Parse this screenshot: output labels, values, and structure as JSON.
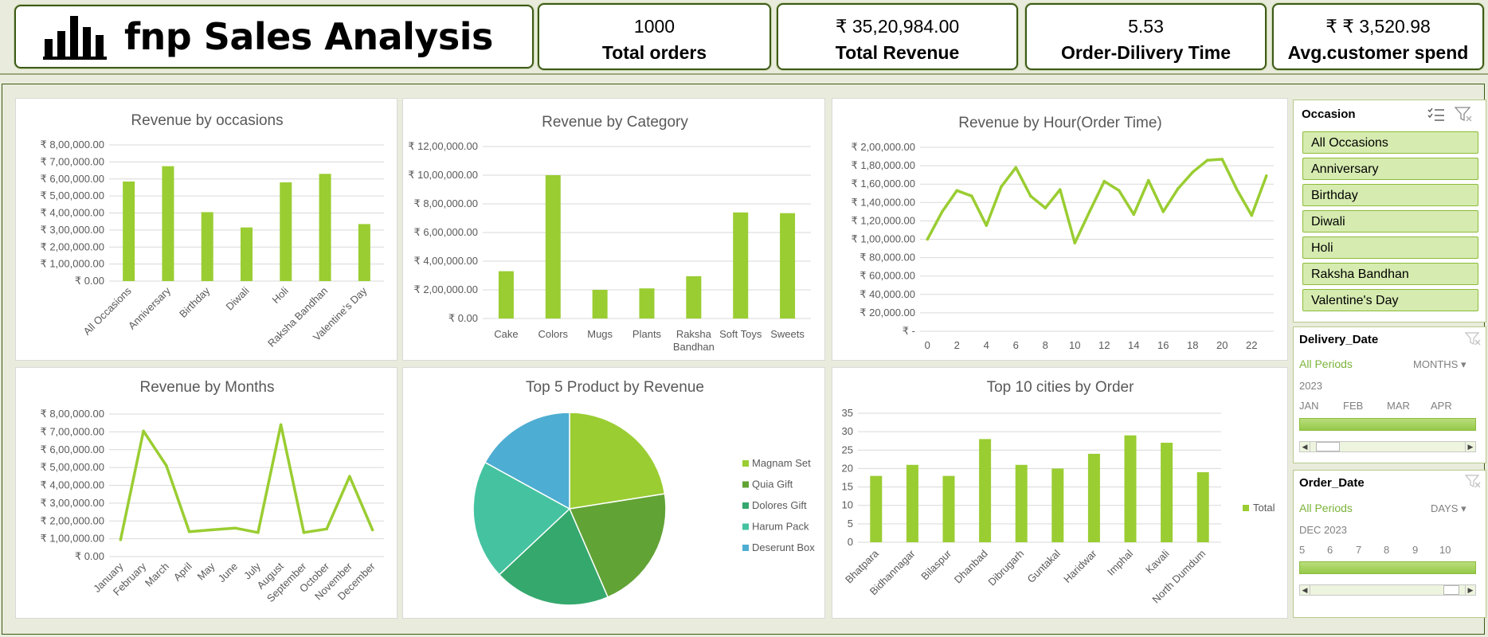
{
  "header": {
    "title": "fnp Sales Analysis",
    "logo_icon": "bar-chart-icon",
    "kpis": [
      {
        "value": "1000",
        "label": "Total orders"
      },
      {
        "value": "₹ 35,20,984.00",
        "label": "Total Revenue"
      },
      {
        "value": "5.53",
        "label": "Order-Dilivery Time"
      },
      {
        "value": "₹ ₹ 3,520.98",
        "label": "Avg.customer spend"
      }
    ]
  },
  "colors": {
    "bar": "#9acd32",
    "line": "#9acd32",
    "grid": "#d9d9d9",
    "accent": "#3c5a16"
  },
  "chart_data": [
    {
      "id": "occasion",
      "type": "bar",
      "title": "Revenue by occasions",
      "categories": [
        "All Occasions",
        "Anniversary",
        "Birthday",
        "Diwali",
        "Holi",
        "Raksha Bandhan",
        "Valentine's Day"
      ],
      "values": [
        585000,
        675000,
        405000,
        315000,
        580000,
        630000,
        335000
      ],
      "ylim": [
        0,
        800000
      ],
      "yticks": [
        0,
        100000,
        200000,
        300000,
        400000,
        500000,
        600000,
        700000,
        800000
      ],
      "ytick_labels": [
        "₹ 0.00",
        "₹ 1,00,000.00",
        "₹ 2,00,000.00",
        "₹ 3,00,000.00",
        "₹ 4,00,000.00",
        "₹ 5,00,000.00",
        "₹ 6,00,000.00",
        "₹ 7,00,000.00",
        "₹ 8,00,000.00"
      ],
      "grid": true
    },
    {
      "id": "category",
      "type": "bar",
      "title": "Revenue by Category",
      "categories": [
        "Cake",
        "Colors",
        "Mugs",
        "Plants",
        "Raksha Bandhan",
        "Soft Toys",
        "Sweets"
      ],
      "values": [
        330000,
        1000000,
        200000,
        210000,
        295000,
        740000,
        735000
      ],
      "ylim": [
        0,
        1200000
      ],
      "yticks": [
        0,
        200000,
        400000,
        600000,
        800000,
        1000000,
        1200000
      ],
      "ytick_labels": [
        "₹ 0.00",
        "₹ 2,00,000.00",
        "₹ 4,00,000.00",
        "₹ 6,00,000.00",
        "₹ 8,00,000.00",
        "₹ 10,00,000.00",
        "₹ 12,00,000.00"
      ],
      "grid": true
    },
    {
      "id": "hour",
      "type": "line",
      "title": "Revenue by Hour(Order Time)",
      "x": [
        0,
        1,
        2,
        3,
        4,
        5,
        6,
        7,
        8,
        9,
        10,
        11,
        12,
        13,
        14,
        15,
        16,
        17,
        18,
        19,
        20,
        21,
        22,
        23
      ],
      "values": [
        100000,
        130000,
        153000,
        147000,
        115000,
        157000,
        178000,
        147000,
        134000,
        154000,
        96000,
        130000,
        163000,
        153000,
        127000,
        164000,
        130000,
        155000,
        173000,
        186000,
        187000,
        154000,
        126000,
        169000
      ],
      "xticks": [
        0,
        2,
        4,
        6,
        8,
        10,
        12,
        14,
        16,
        18,
        20,
        22
      ],
      "ylim": [
        0,
        200000
      ],
      "yticks": [
        0,
        20000,
        40000,
        60000,
        80000,
        100000,
        120000,
        140000,
        160000,
        180000,
        200000
      ],
      "ytick_labels": [
        "₹ -",
        "₹ 20,000.00",
        "₹ 40,000.00",
        "₹ 60,000.00",
        "₹ 80,000.00",
        "₹ 1,00,000.00",
        "₹ 1,20,000.00",
        "₹ 1,40,000.00",
        "₹ 1,60,000.00",
        "₹ 1,80,000.00",
        "₹ 2,00,000.00"
      ],
      "grid": true
    },
    {
      "id": "months",
      "type": "line",
      "title": "Revenue by Months",
      "categories": [
        "January",
        "February",
        "March",
        "April",
        "May",
        "June",
        "July",
        "August",
        "September",
        "October",
        "November",
        "December"
      ],
      "values": [
        95000,
        705000,
        510000,
        140000,
        150000,
        160000,
        135000,
        740000,
        135000,
        155000,
        450000,
        150000
      ],
      "ylim": [
        0,
        800000
      ],
      "yticks": [
        0,
        100000,
        200000,
        300000,
        400000,
        500000,
        600000,
        700000,
        800000
      ],
      "ytick_labels": [
        "₹ 0.00",
        "₹ 1,00,000.00",
        "₹ 2,00,000.00",
        "₹ 3,00,000.00",
        "₹ 4,00,000.00",
        "₹ 5,00,000.00",
        "₹ 6,00,000.00",
        "₹ 7,00,000.00",
        "₹ 8,00,000.00"
      ],
      "grid": true
    },
    {
      "id": "products",
      "type": "pie",
      "title": "Top 5 Product by Revenue",
      "categories": [
        "Magnam Set",
        "Quia Gift",
        "Dolores Gift",
        "Harum Pack",
        "Deserunt Box"
      ],
      "values": [
        22.5,
        21,
        19.5,
        20,
        17
      ],
      "colors": [
        "#9acd32",
        "#62a336",
        "#35a86e",
        "#45c3a0",
        "#4eadd2"
      ],
      "legend": "right"
    },
    {
      "id": "cities",
      "type": "bar",
      "title": "Top 10 cities by Order",
      "categories": [
        "Bhatpara",
        "Bidhannagar",
        "Bilaspur",
        "Dhanbad",
        "Dibrugarh",
        "Guntakal",
        "Haridwar",
        "Imphal",
        "Kavali",
        "North Dumdum"
      ],
      "series": [
        {
          "name": "Total",
          "values": [
            18,
            21,
            18,
            28,
            21,
            20,
            24,
            29,
            27,
            19
          ]
        }
      ],
      "ylim": [
        0,
        35
      ],
      "yticks": [
        0,
        5,
        10,
        15,
        20,
        25,
        30,
        35
      ],
      "ytick_labels": [
        "0",
        "5",
        "10",
        "15",
        "20",
        "25",
        "30",
        "35"
      ],
      "grid": true,
      "legend": "right"
    }
  ],
  "slicers": {
    "occasion": {
      "title": "Occasion",
      "items": [
        "All Occasions",
        "Anniversary",
        "Birthday",
        "Diwali",
        "Holi",
        "Raksha Bandhan",
        "Valentine's Day"
      ]
    },
    "delivery": {
      "title": "Delivery_Date",
      "period": "All Periods",
      "unit": "MONTHS",
      "year": "2023",
      "ticks": [
        "JAN",
        "FEB",
        "MAR",
        "APR"
      ]
    },
    "order": {
      "title": "Order_Date",
      "period": "All Periods",
      "unit": "DAYS",
      "year": "DEC 2023",
      "ticks": [
        "5",
        "6",
        "7",
        "8",
        "9",
        "10"
      ]
    }
  }
}
